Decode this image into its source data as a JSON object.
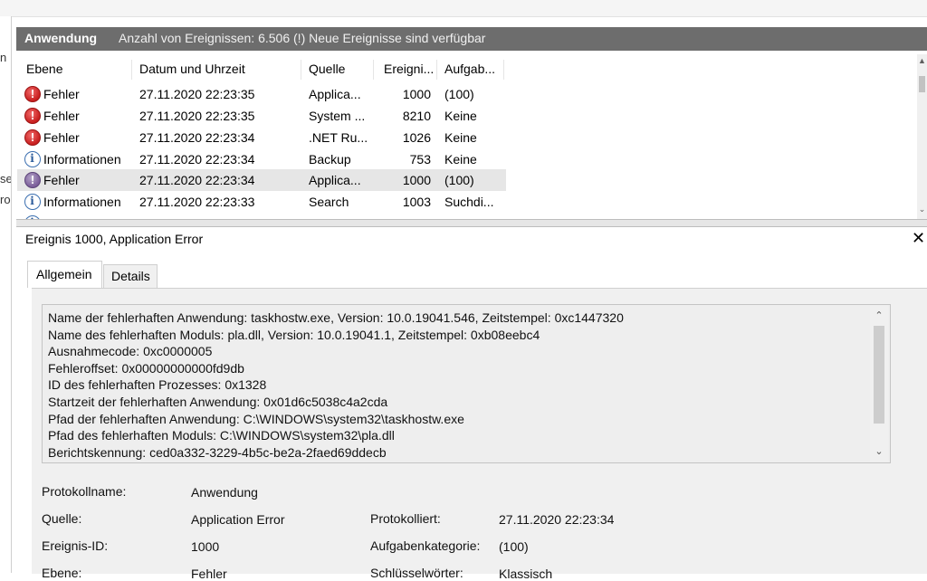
{
  "left_pane": {
    "frag1": "n",
    "frag2": "se",
    "frag3": "ro"
  },
  "header": {
    "title": "Anwendung",
    "info": "Anzahl von Ereignissen: 6.506 (!) Neue Ereignisse sind verfügbar"
  },
  "columns": [
    "Ebene",
    "Datum und Uhrzeit",
    "Quelle",
    "Ereigni...",
    "Aufgab..."
  ],
  "events": [
    {
      "icon": "error-icon",
      "level": "Fehler",
      "date": "27.11.2020 22:23:35",
      "source": "Applica...",
      "id": "1000",
      "task": "(100)"
    },
    {
      "icon": "error-icon",
      "level": "Fehler",
      "date": "27.11.2020 22:23:35",
      "source": "System ...",
      "id": "8210",
      "task": "Keine"
    },
    {
      "icon": "error-icon",
      "level": "Fehler",
      "date": "27.11.2020 22:23:34",
      "source": ".NET Ru...",
      "id": "1026",
      "task": "Keine"
    },
    {
      "icon": "info-icon",
      "level": "Informationen",
      "date": "27.11.2020 22:23:34",
      "source": "Backup",
      "id": "753",
      "task": "Keine"
    },
    {
      "icon": "error-icon",
      "level": "Fehler",
      "date": "27.11.2020 22:23:34",
      "source": "Applica...",
      "id": "1000",
      "task": "(100)",
      "selected": true
    },
    {
      "icon": "info-icon",
      "level": "Informationen",
      "date": "27.11.2020 22:23:33",
      "source": "Search",
      "id": "1003",
      "task": "Suchdi..."
    }
  ],
  "detail": {
    "title": "Ereignis 1000, Application Error",
    "tabs": [
      "Allgemein",
      "Details"
    ],
    "description_lines": [
      "Name der fehlerhaften Anwendung: taskhostw.exe, Version: 10.0.19041.546, Zeitstempel: 0xc1447320",
      "Name des fehlerhaften Moduls: pla.dll, Version: 10.0.19041.1, Zeitstempel: 0xb08eebc4",
      "Ausnahmecode: 0xc0000005",
      "Fehleroffset: 0x00000000000fd9db",
      "ID des fehlerhaften Prozesses: 0x1328",
      "Startzeit der fehlerhaften Anwendung: 0x01d6c5038c4a2cda",
      "Pfad der fehlerhaften Anwendung: C:\\WINDOWS\\system32\\taskhostw.exe",
      "Pfad des fehlerhaften Moduls: C:\\WINDOWS\\system32\\pla.dll",
      "Berichtskennung: ced0a332-3229-4b5c-be2a-2faed69ddecb"
    ],
    "fields": {
      "protokollname_label": "Protokollname:",
      "protokollname_value": "Anwendung",
      "quelle_label": "Quelle:",
      "quelle_value": "Application Error",
      "protokolliert_label": "Protokolliert:",
      "protokolliert_value": "27.11.2020 22:23:34",
      "ereignis_id_label": "Ereignis-ID:",
      "ereignis_id_value": "1000",
      "aufgabenkategorie_label": "Aufgabenkategorie:",
      "aufgabenkategorie_value": "(100)",
      "ebene_label": "Ebene:",
      "ebene_value": "Fehler",
      "schluesselwoerter_label": "Schlüsselwörter:",
      "schluesselwoerter_value": "Klassisch"
    }
  }
}
